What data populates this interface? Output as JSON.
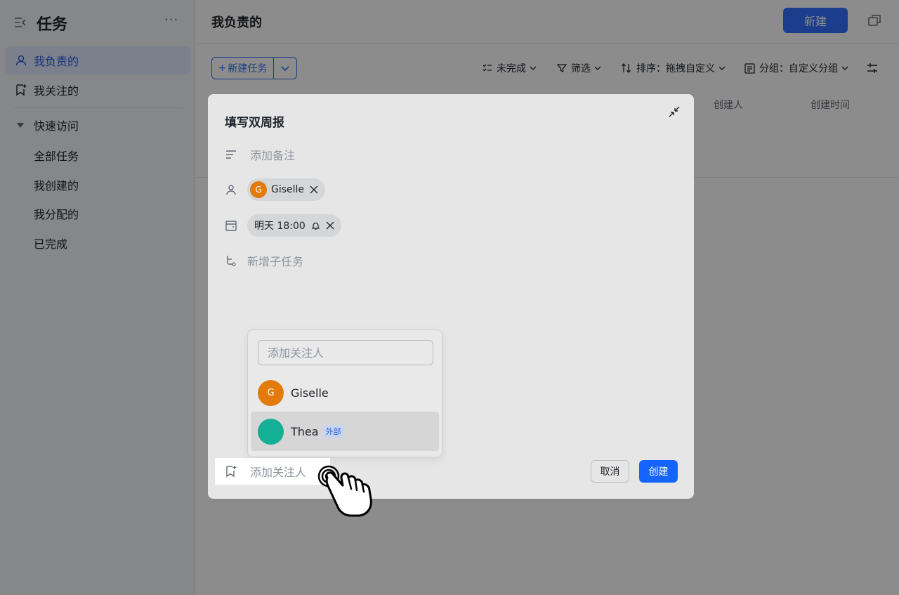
{
  "sidebar": {
    "title": "任务",
    "more": "···",
    "items": [
      {
        "label": "我负责的",
        "icon": "user-icon"
      },
      {
        "label": "我关注的",
        "icon": "bookmark-icon"
      }
    ],
    "quick_access": {
      "label": "快速访问",
      "items": [
        "全部任务",
        "我创建的",
        "我分配的",
        "已完成"
      ]
    }
  },
  "header": {
    "title": "我负责的",
    "new_button": "新建"
  },
  "toolbar": {
    "new_task": "新建任务",
    "status": "未完成",
    "filter": "筛选",
    "sort": "排序：拖拽自定义",
    "group": "分组：自定义分组"
  },
  "table": {
    "columns": [
      "创建人",
      "创建时间"
    ]
  },
  "dialog": {
    "title": "填写双周报",
    "note_placeholder": "添加备注",
    "assignee": {
      "name": "Giselle",
      "initial": "G"
    },
    "due": "明天 18:00",
    "subtask_placeholder": "新增子任务",
    "follower_label": "添加关注人",
    "cancel": "取消",
    "create": "创建",
    "dropdown": {
      "search_placeholder": "添加关注人",
      "options": [
        {
          "name": "Giselle",
          "initial": "G",
          "color": "#e37a0c"
        },
        {
          "name": "Thea",
          "initial": "",
          "color": "#14b096",
          "badge": "外部"
        }
      ]
    }
  },
  "colors": {
    "accent": "#3370ff",
    "primary_button": "#1664ff",
    "avatar_orange": "#e37a0c",
    "avatar_teal": "#14b096"
  }
}
